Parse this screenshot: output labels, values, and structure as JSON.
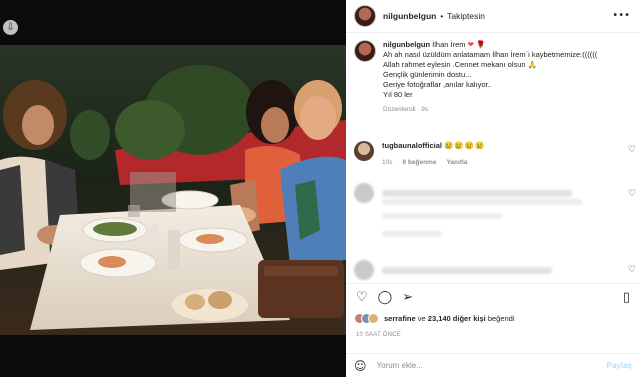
{
  "post": {
    "username": "nilgunbelgun",
    "follow_status": "Takiptesin",
    "caption": {
      "username": "nilgunbelgun",
      "line1": "İlhan İrem",
      "line2": "Ah ah nasıl üzüldüm anlatamam İlhan İrem`i kaybetmemize:((((((",
      "line3": "Allah rahmet eylesin .Cennet mekanı olsun",
      "line4": "Gençlik günlerimin dostu...",
      "line5": "Geriye fotoğraflar ,anılar kalıyor..",
      "line6": "Yıl 80 ler",
      "meta": "Düzenlendi · 9s"
    },
    "comment": {
      "username": "tugbaunalofficial",
      "emojis": "😢😢😢😢",
      "time": "10s",
      "likes": "6 beğenme",
      "reply": "Yanıtla"
    },
    "likes_text_prefix": "serrafine",
    "likes_text_mid": " ve ",
    "likes_text_count": "23,140 diğer kişi",
    "likes_text_suffix": " beğendi",
    "timestamp": "10 SAAT ÖNCE",
    "comment_placeholder": "Yorum ekle...",
    "post_button": "Paylaş"
  },
  "colors": {
    "heart": "#ed4956",
    "post_button": "#b2dffc",
    "meta_gray": "#8e8e8e"
  }
}
